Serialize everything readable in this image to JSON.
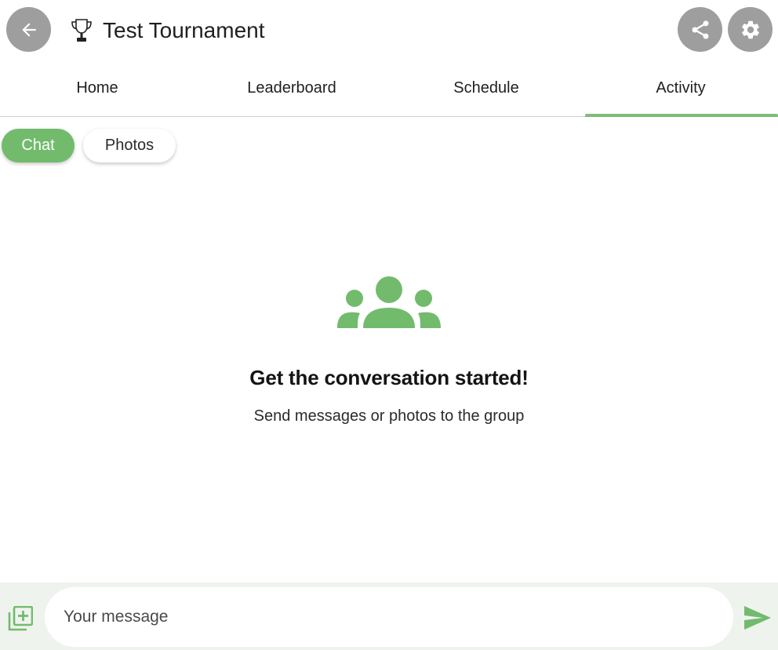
{
  "header": {
    "title": "Test Tournament",
    "back_icon": "arrow-back-icon",
    "title_icon": "trophy-icon",
    "actions": [
      "share-icon",
      "settings-icon"
    ]
  },
  "tabs": [
    {
      "label": "Home",
      "selected": false
    },
    {
      "label": "Leaderboard",
      "selected": false
    },
    {
      "label": "Schedule",
      "selected": false
    },
    {
      "label": "Activity",
      "selected": true
    }
  ],
  "chips": [
    {
      "label": "Chat",
      "selected": true
    },
    {
      "label": "Photos",
      "selected": false
    }
  ],
  "empty_state": {
    "icon": "group-icon",
    "title": "Get the conversation started!",
    "subtitle": "Send messages or photos to the group"
  },
  "composer": {
    "placeholder": "Your message",
    "value": "",
    "attach_icon": "add-photo-icon",
    "send_icon": "send-icon"
  },
  "colors": {
    "accent": "#72bb6d",
    "button_gray": "#9e9e9e",
    "composer_bg": "#eff3ee"
  }
}
